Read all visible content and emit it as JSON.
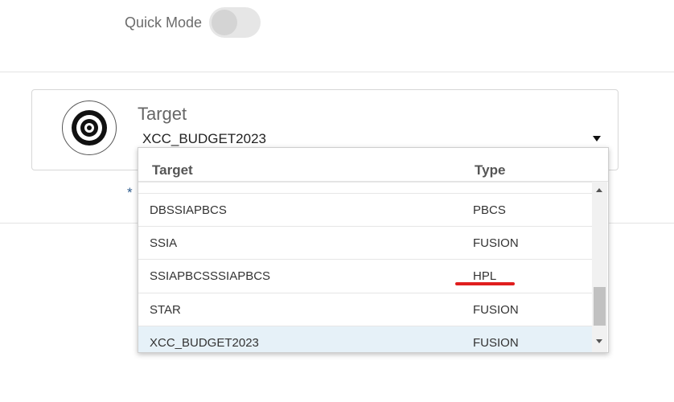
{
  "quick_mode": {
    "label": "Quick Mode",
    "enabled": false
  },
  "target_card": {
    "title": "Target",
    "selected_value": "XCC_BUDGET2023",
    "required_marker": "*"
  },
  "dropdown": {
    "headers": {
      "target": "Target",
      "type": "Type"
    },
    "rows": [
      {
        "target": "DBSSIAPBCS",
        "type": "PBCS"
      },
      {
        "target": "SSIA",
        "type": "FUSION"
      },
      {
        "target": "SSIAPBCSSSIAPBCS",
        "type": "HPL"
      },
      {
        "target": "STAR",
        "type": "FUSION"
      },
      {
        "target": "XCC_BUDGET2023",
        "type": "FUSION"
      }
    ],
    "selected_row": "XCC_BUDGET2023",
    "highlighted_type": "HPL"
  },
  "colors": {
    "selected_row": "#e6f1f8",
    "annotation": "#e01e1e",
    "required": "#2d5a8c"
  },
  "icons": {
    "target": "bullseye-icon",
    "select": "caret-down-icon",
    "scroll_up": "scroll-up-arrow",
    "scroll_down": "scroll-down-arrow"
  }
}
